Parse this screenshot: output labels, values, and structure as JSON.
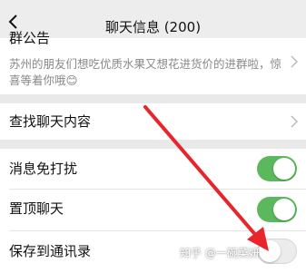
{
  "header": {
    "title": "聊天信息 (200)",
    "back_icon": "chevron-left-icon"
  },
  "notice": {
    "label_partial": "群公告",
    "text": "苏州的朋友们想吃优质水果又想花进货价的进群啦，惊喜等着你哦😊"
  },
  "search_history": {
    "label": "查找聊天内容"
  },
  "settings": {
    "mute": {
      "label": "消息免打扰",
      "on": true
    },
    "pin": {
      "label": "置顶聊天",
      "on": true
    },
    "save_contacts": {
      "label": "保存到通讯录",
      "on": false
    }
  },
  "watermark": "知乎 @一碗菜妍",
  "colors": {
    "accent_green": "#5cb85c",
    "annotation_red": "#e8242c",
    "background": "#e9e9e9"
  }
}
